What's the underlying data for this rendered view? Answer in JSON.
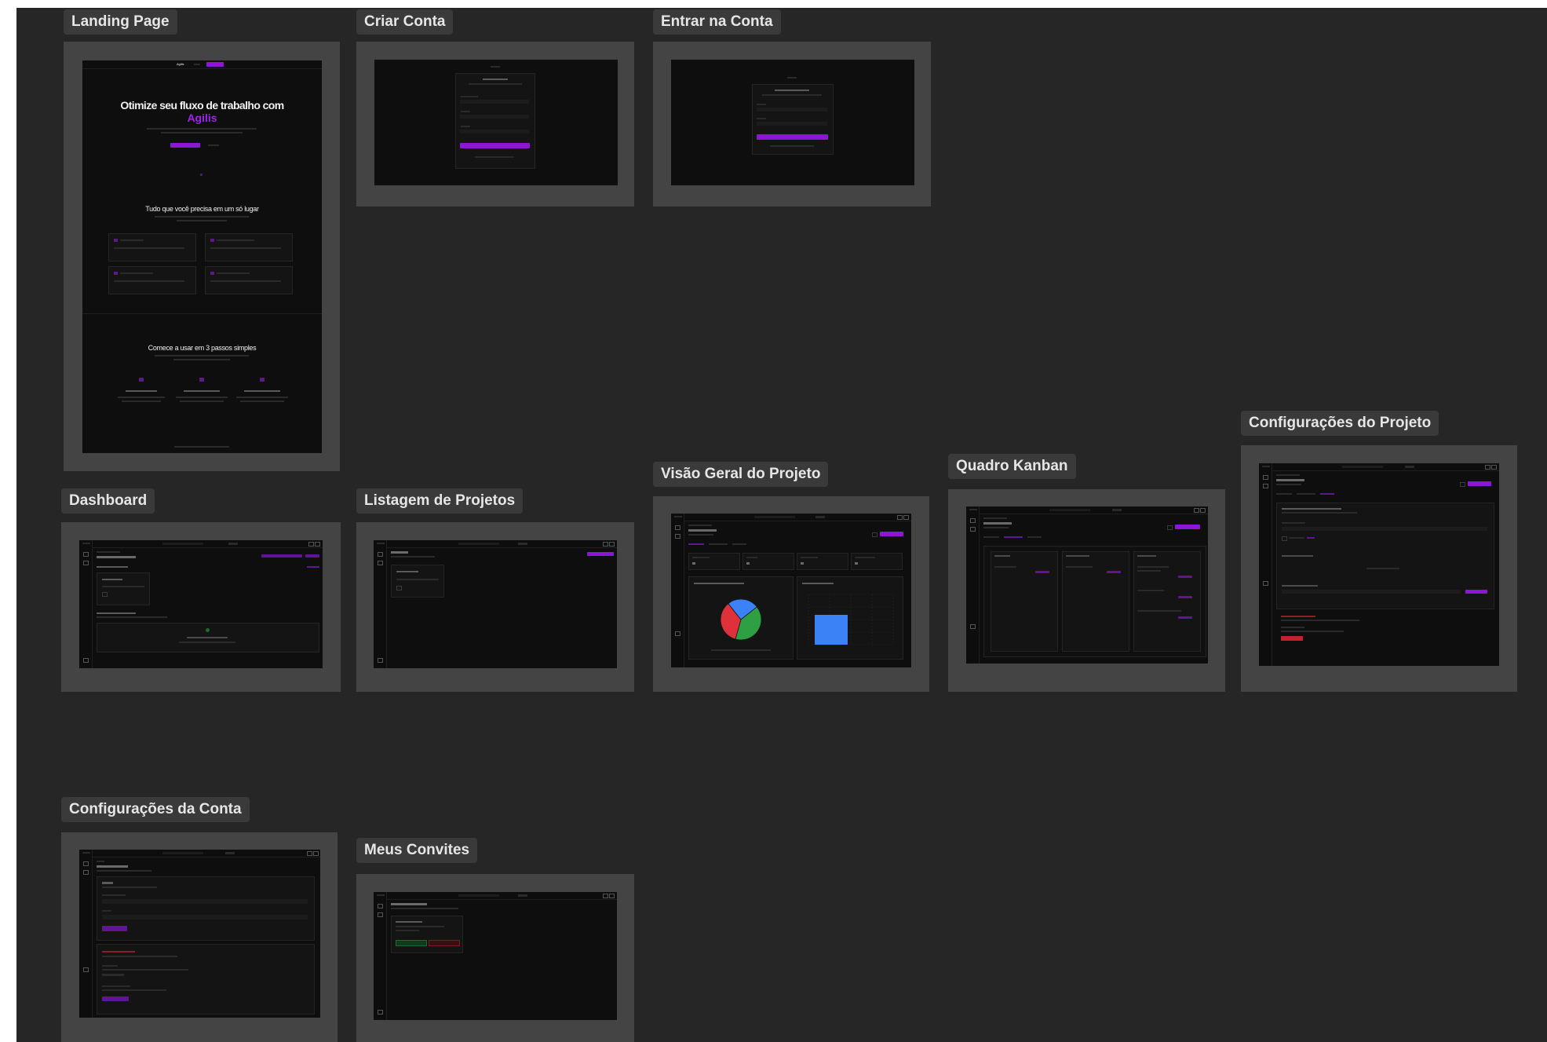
{
  "frames": {
    "landing": {
      "label": "Landing Page",
      "logo": "Agilis",
      "hero_title": "Otimize seu fluxo de trabalho com",
      "hero_brand": "Agilis",
      "section_title": "Tudo que você precisa em um só lugar",
      "steps_title": "Comece a usar em 3 passos simples"
    },
    "signup": {
      "label": "Criar Conta"
    },
    "login": {
      "label": "Entrar na Conta"
    },
    "dashboard": {
      "label": "Dashboard"
    },
    "projects": {
      "label": "Listagem de Projetos"
    },
    "overview": {
      "label": "Visão Geral do Projeto"
    },
    "kanban": {
      "label": "Quadro Kanban"
    },
    "project_settings": {
      "label": "Configurações do Projeto"
    },
    "account_settings": {
      "label": "Configurações da Conta"
    },
    "invites": {
      "label": "Meus Convites"
    }
  },
  "colors": {
    "canvas": "#262626",
    "frame": "#444444",
    "screen": "#0e0e0e",
    "accent": "#8b16d6",
    "danger": "#e0303a"
  },
  "chart_data": [
    {
      "type": "pie",
      "values": [
        40,
        35,
        25
      ],
      "colors": [
        "#2ea043",
        "#e0303a",
        "#3b82f6"
      ]
    },
    {
      "type": "bar",
      "values": [
        1
      ],
      "colors": [
        "#3b82f6"
      ]
    }
  ]
}
